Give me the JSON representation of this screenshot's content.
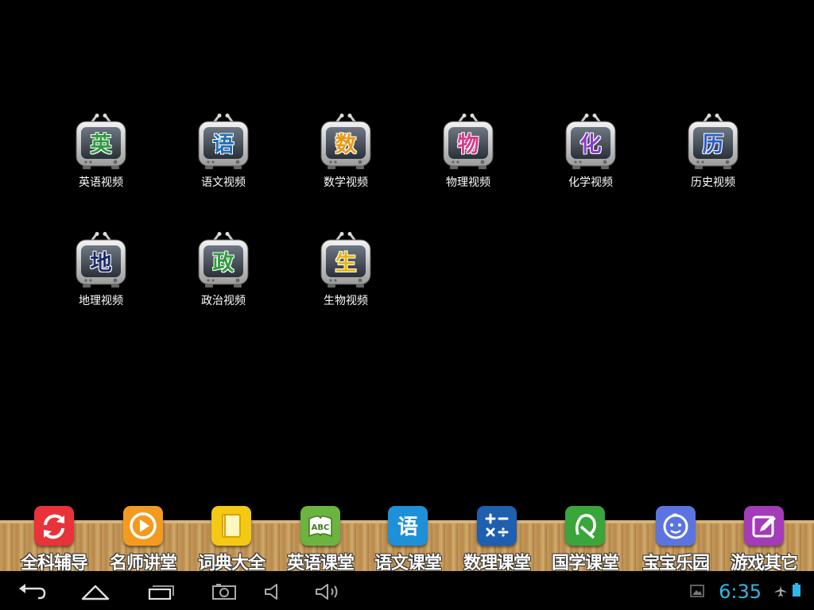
{
  "apps": [
    {
      "label": "英语视频",
      "glyph": "英",
      "color": "#2e9d3e"
    },
    {
      "label": "语文视频",
      "glyph": "语",
      "color": "#1f6fb8"
    },
    {
      "label": "数学视频",
      "glyph": "数",
      "color": "#e89a18"
    },
    {
      "label": "物理视频",
      "glyph": "物",
      "color": "#d93a8b"
    },
    {
      "label": "化学视频",
      "glyph": "化",
      "color": "#8b3bc9"
    },
    {
      "label": "历史视频",
      "glyph": "历",
      "color": "#2a5bd0"
    },
    {
      "label": "地理视频",
      "glyph": "地",
      "color": "#1e2a6b"
    },
    {
      "label": "政治视频",
      "glyph": "政",
      "color": "#2e9d3e"
    },
    {
      "label": "生物视频",
      "glyph": "生",
      "color": "#e8b80d"
    }
  ],
  "dock": [
    {
      "label": "全科辅导",
      "icon": "refresh-icon",
      "color": "#e8333a"
    },
    {
      "label": "名师讲堂",
      "icon": "play-icon",
      "color": "#f39a1f"
    },
    {
      "label": "词典大全",
      "icon": "book-icon",
      "color": "#f5c814"
    },
    {
      "label": "英语课堂",
      "icon": "abc-book-icon",
      "color": "#6cb33f"
    },
    {
      "label": "语文课堂",
      "icon": "yu-char-icon",
      "color": "#1e90d8",
      "glyph": "语"
    },
    {
      "label": "数理课堂",
      "icon": "math-symbols-icon",
      "color": "#1f5fb0"
    },
    {
      "label": "国学课堂",
      "icon": "scroll-icon",
      "color": "#3aa53a"
    },
    {
      "label": "宝宝乐园",
      "icon": "baby-face-icon",
      "color": "#5b74e0"
    },
    {
      "label": "游戏其它",
      "icon": "pencil-note-icon",
      "color": "#a43bb8"
    }
  ],
  "statusbar": {
    "time": "6:35",
    "accent": "#33b5e5"
  },
  "navbar": {
    "icons": [
      "back-icon",
      "home-icon",
      "recent-apps-icon",
      "screenshot-icon",
      "volume-down-icon",
      "volume-up-icon"
    ]
  }
}
